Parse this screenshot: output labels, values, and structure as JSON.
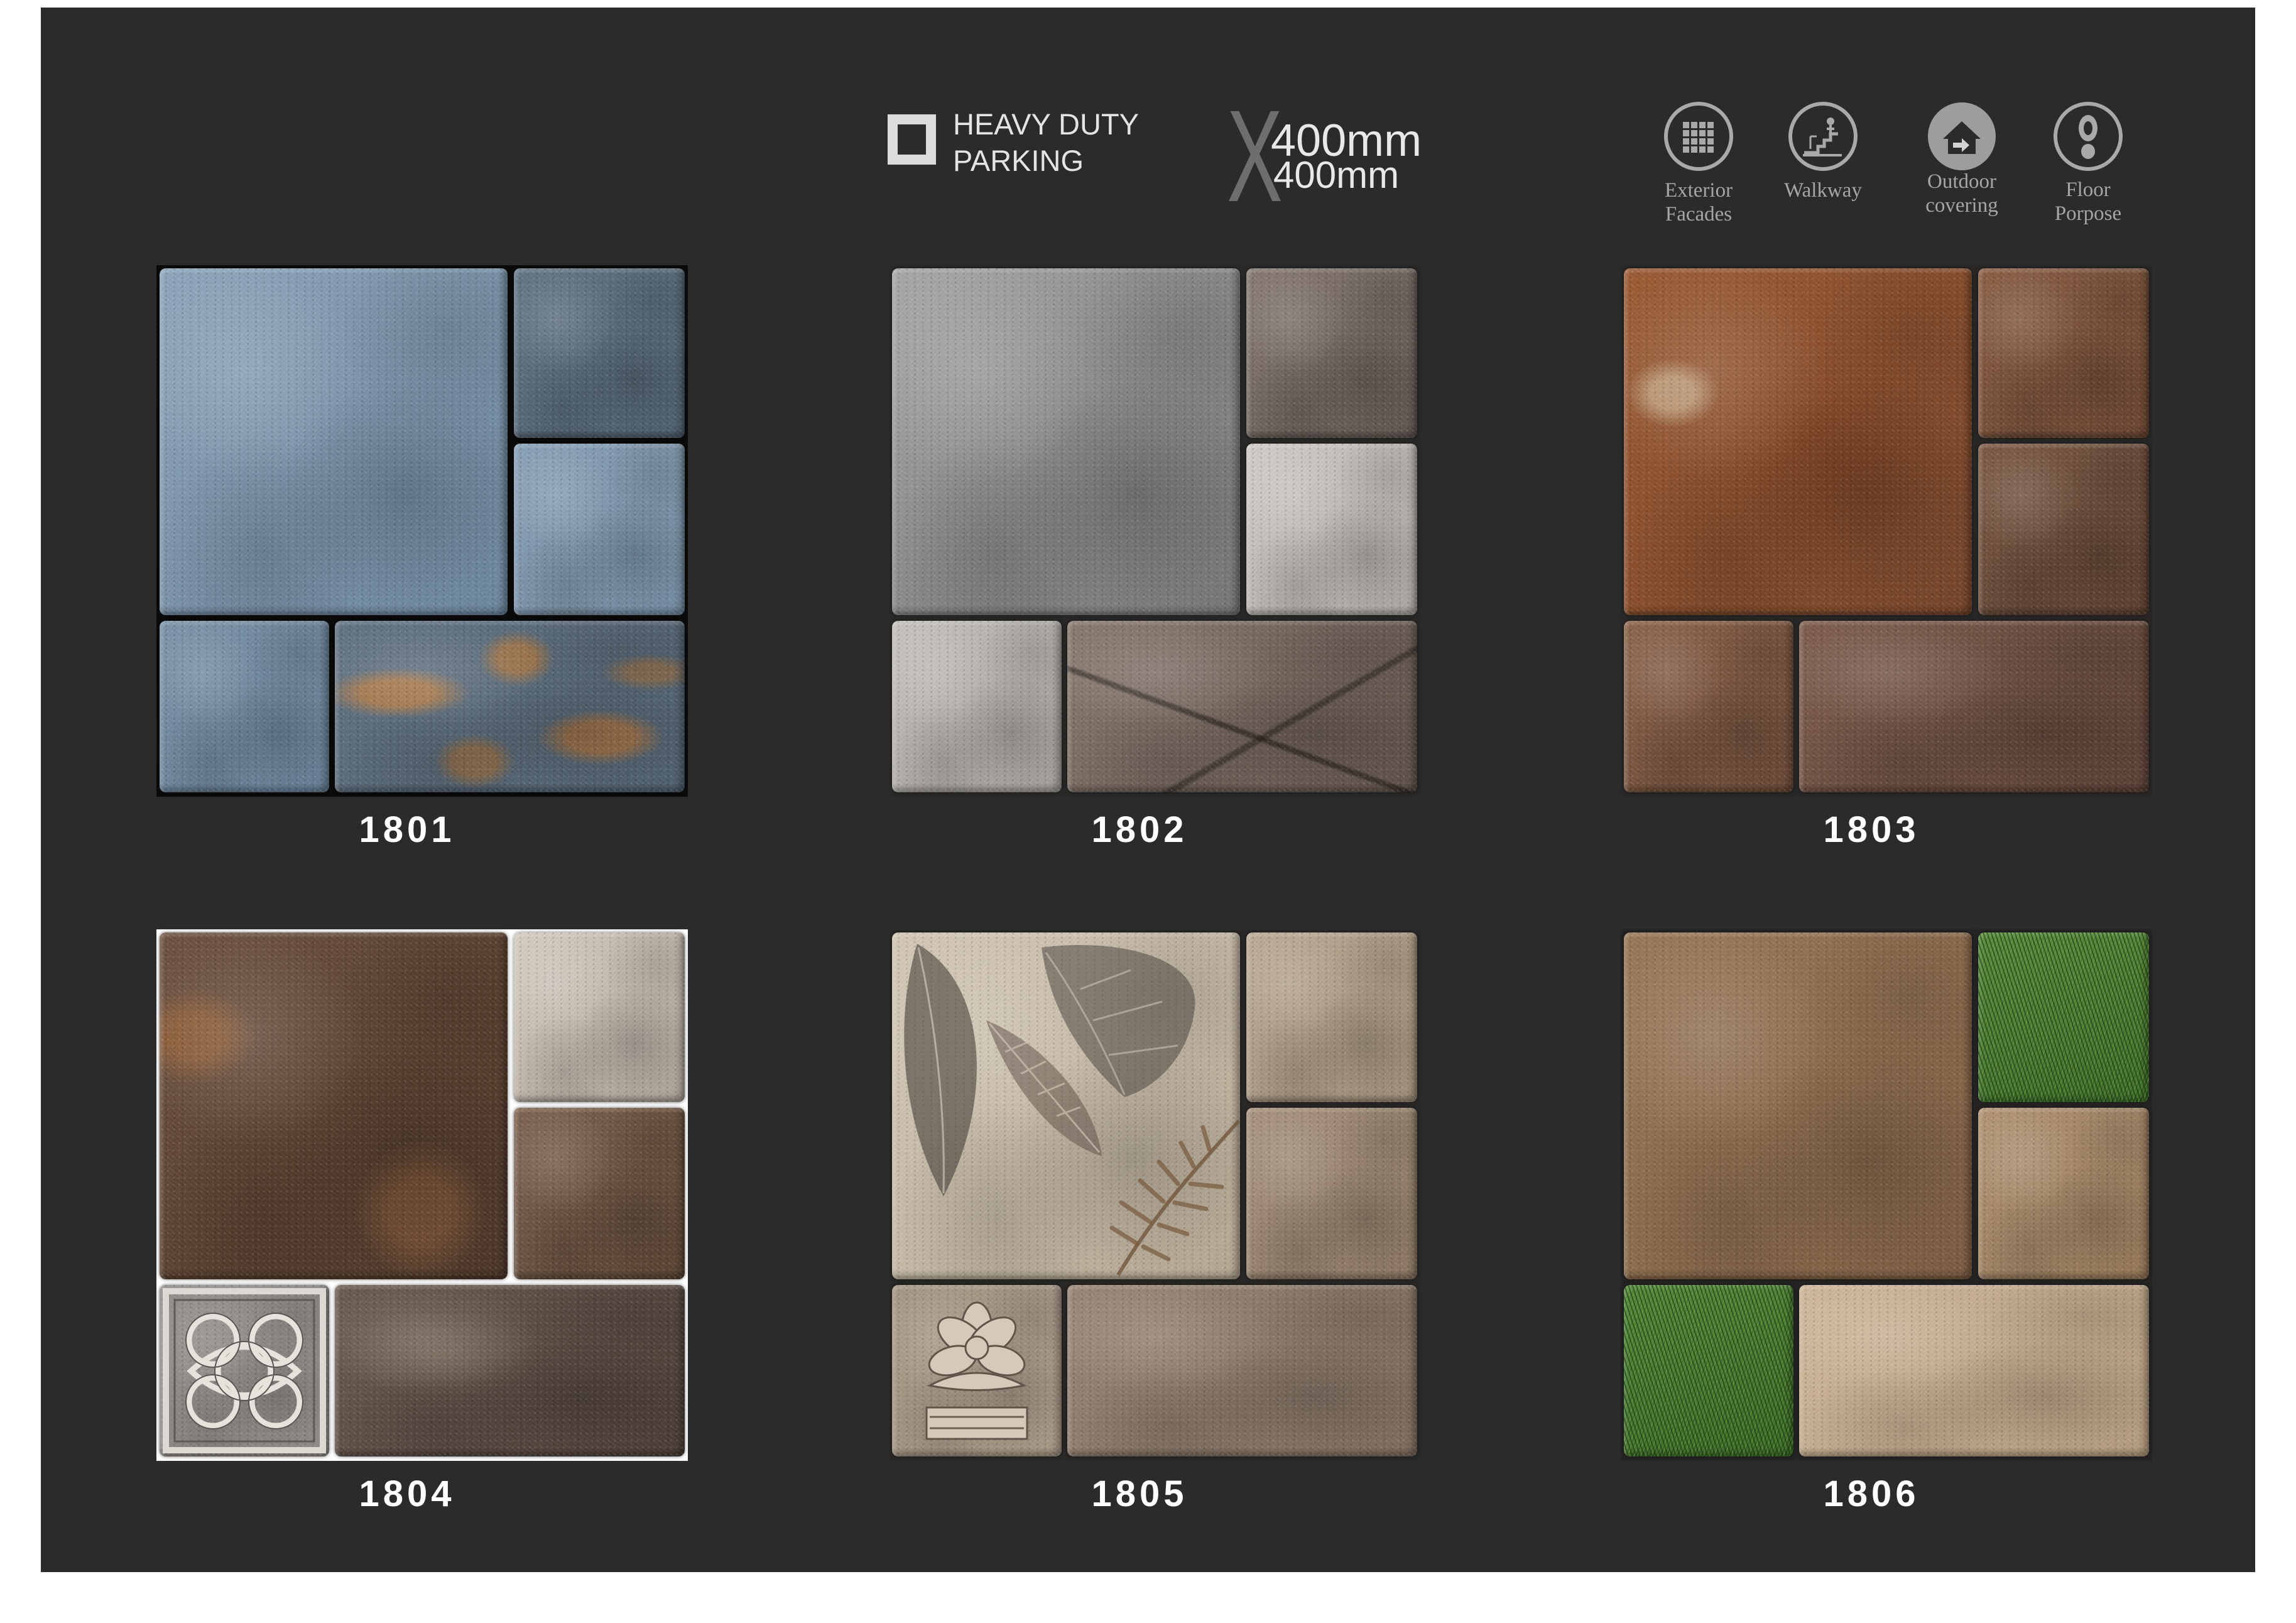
{
  "header": {
    "feature_icon": "square-outline-icon",
    "feature_line1": "HEAVY DUTY",
    "feature_line2": "PARKING",
    "size_separator": "X",
    "size_line1": "400mm",
    "size_line2": "400mm"
  },
  "applications": [
    {
      "icon": "facade-grid-icon",
      "label": [
        "Exterior",
        "Facades"
      ]
    },
    {
      "icon": "walkway-icon",
      "label": [
        "Walkway"
      ]
    },
    {
      "icon": "outdoor-covering-icon",
      "label": [
        "Outdoor",
        "covering"
      ]
    },
    {
      "icon": "footprint-icon",
      "label": [
        "Floor",
        "Porpose"
      ]
    }
  ],
  "tiles": [
    {
      "code": "1801",
      "grout_color": "#0b0b0b"
    },
    {
      "code": "1802",
      "grout_color": "#2a2928"
    },
    {
      "code": "1803",
      "grout_color": "#2a2827"
    },
    {
      "code": "1804",
      "grout_color": "#ffffff"
    },
    {
      "code": "1805",
      "grout_color": "#2b2927"
    },
    {
      "code": "1806",
      "grout_color": "#262524"
    }
  ],
  "colors": {
    "page": "#ffffff",
    "panel": "#2c2b2b",
    "text_light": "#e4e4e4",
    "text_muted": "#a5a5a5"
  }
}
